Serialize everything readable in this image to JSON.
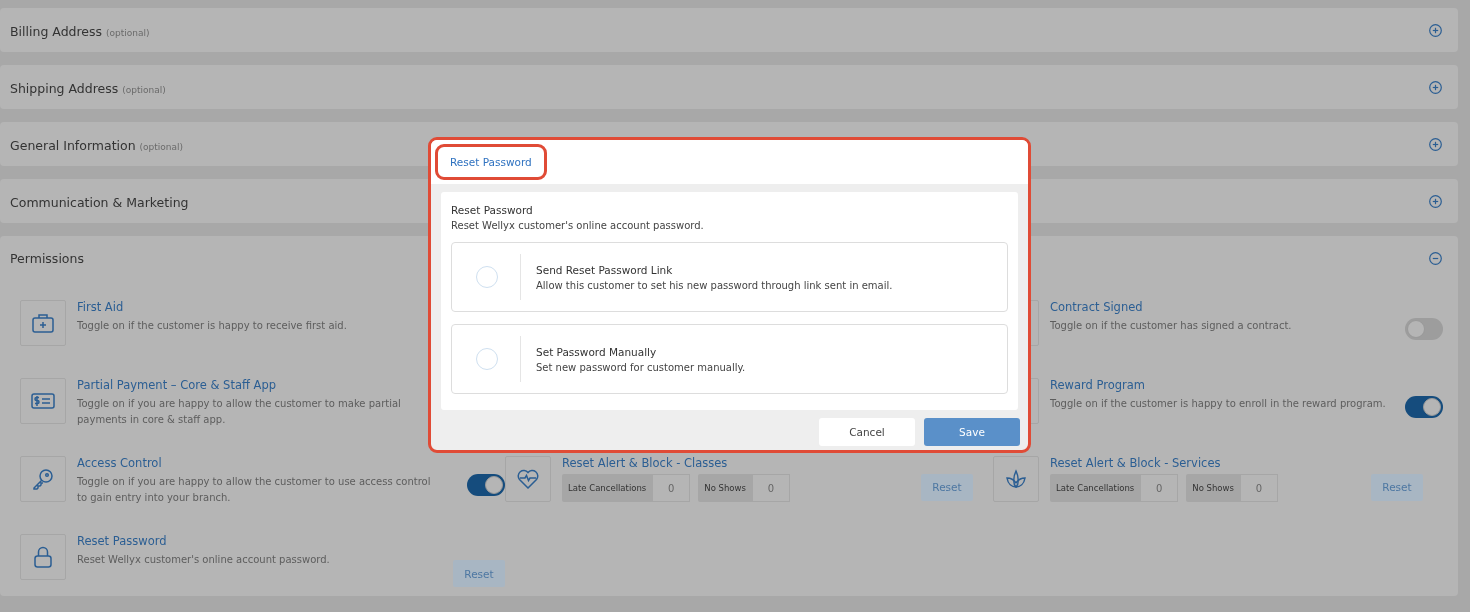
{
  "sections": [
    {
      "title": "Billing Address",
      "note": "(optional)",
      "expanded": false
    },
    {
      "title": "Shipping Address",
      "note": "(optional)",
      "expanded": false
    },
    {
      "title": "General Information",
      "note": "(optional)",
      "expanded": false
    },
    {
      "title": "Communication & Marketing",
      "expanded": false
    }
  ],
  "permissions": {
    "title": "Permissions",
    "expanded": true,
    "rows": [
      [
        {
          "kind": "info",
          "title": "First Aid",
          "text": "Toggle on if the customer is happy to receive first aid."
        },
        null,
        {
          "kind": "toggle",
          "title": "Contract Signed",
          "text": "Toggle on if the customer has signed a contract.",
          "on": false
        }
      ],
      [
        {
          "kind": "info",
          "title": "Partial Payment – Core & Staff App",
          "text": "Toggle on if you are happy to allow the customer to make partial payments in core & staff app."
        },
        null,
        {
          "kind": "toggle",
          "title": "Reward Program",
          "text": "Toggle on if the customer is happy to enroll in the reward program.",
          "on": true
        }
      ],
      [
        {
          "kind": "toggle",
          "title": "Access Control",
          "text": "Toggle on if you are happy to allow the customer to use access control to gain entry into your branch.",
          "on": true
        },
        {
          "kind": "counters",
          "title": "Reset Alert & Block - Classes",
          "fields": [
            {
              "label": "Late Cancellations",
              "value": "0"
            },
            {
              "label": "No Shows",
              "value": "0"
            }
          ],
          "button": "Reset"
        },
        {
          "kind": "counters",
          "title": "Reset Alert & Block - Services",
          "fields": [
            {
              "label": "Late Cancellations",
              "value": "0"
            },
            {
              "label": "No Shows",
              "value": "0"
            }
          ],
          "button": "Reset"
        }
      ],
      [
        {
          "kind": "reset",
          "title": "Reset Password",
          "text": "Reset Wellyx customer's online account password.",
          "button": "Reset"
        },
        null,
        null
      ]
    ]
  },
  "modal": {
    "tab": "Reset Password",
    "heading": "Reset Password",
    "text": "Reset Wellyx customer's online account password.",
    "options": [
      {
        "title": "Send Reset Password Link",
        "text": "Allow this customer to set his new password through link sent in email.",
        "selected": false
      },
      {
        "title": "Set Password Manually",
        "text": "Set new password for customer manually.",
        "selected": false
      }
    ],
    "cancel": "Cancel",
    "save": "Save"
  }
}
